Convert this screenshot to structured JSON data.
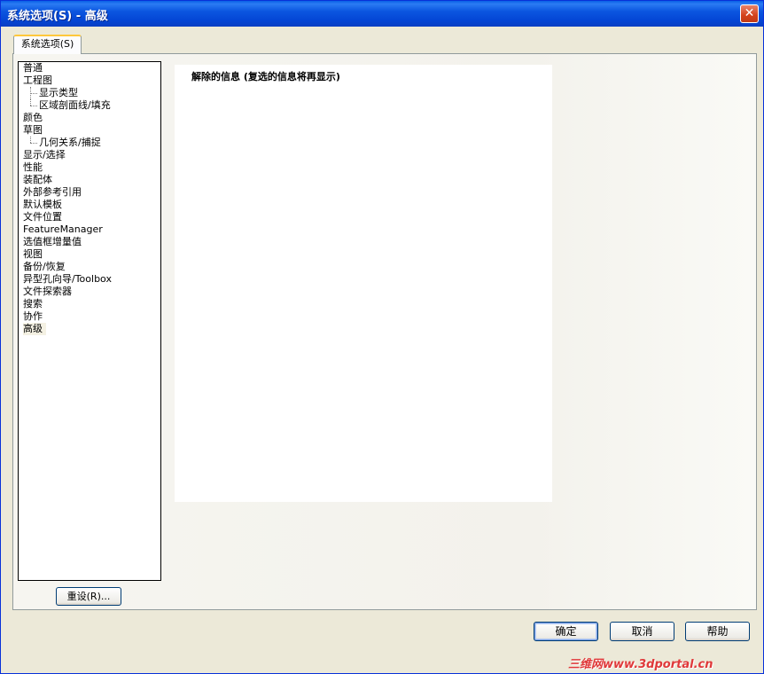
{
  "window": {
    "title": "系统选项(S) - 高级",
    "close_icon": "close-icon"
  },
  "tabs": [
    {
      "label": "系统选项(S)",
      "selected": true
    }
  ],
  "tree": {
    "items": [
      {
        "label": "普通"
      },
      {
        "label": "工程图"
      },
      {
        "label": "显示类型",
        "child": true
      },
      {
        "label": "区域剖面线/填充",
        "child": true
      },
      {
        "label": "颜色"
      },
      {
        "label": "草图"
      },
      {
        "label": "几何关系/捕捉",
        "child": true
      },
      {
        "label": "显示/选择"
      },
      {
        "label": "性能"
      },
      {
        "label": "装配体"
      },
      {
        "label": "外部参考引用"
      },
      {
        "label": "默认模板"
      },
      {
        "label": "文件位置"
      },
      {
        "label": "FeatureManager"
      },
      {
        "label": "选值框增量值"
      },
      {
        "label": "视图"
      },
      {
        "label": "备份/恢复"
      },
      {
        "label": "异型孔向导/Toolbox"
      },
      {
        "label": "文件探索器"
      },
      {
        "label": "搜索"
      },
      {
        "label": "协作"
      },
      {
        "label": "高级",
        "selected": true
      }
    ],
    "reset_label": "重设(R)..."
  },
  "content": {
    "header": "解除的信息 (复选的信息将再显示)"
  },
  "buttons": {
    "ok": "确定",
    "cancel": "取消",
    "help": "帮助"
  },
  "watermark": "三维网www.3dportal.cn"
}
